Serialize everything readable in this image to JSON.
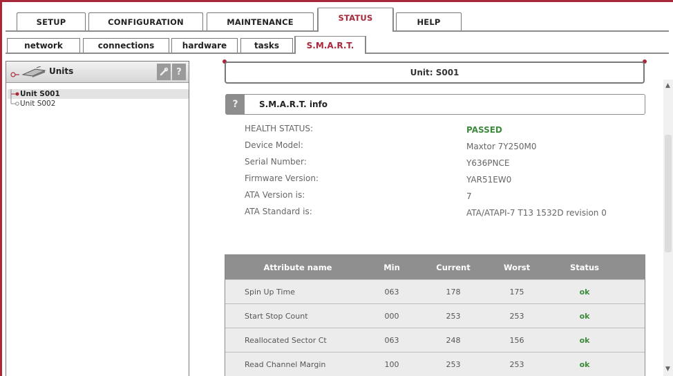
{
  "main_tabs": [
    {
      "label": "SETUP",
      "active": false
    },
    {
      "label": "CONFIGURATION",
      "active": false
    },
    {
      "label": "MAINTENANCE",
      "active": false
    },
    {
      "label": "STATUS",
      "active": true
    },
    {
      "label": "HELP",
      "active": false
    }
  ],
  "sub_tabs": [
    {
      "label": "network",
      "active": false
    },
    {
      "label": "connections",
      "active": false
    },
    {
      "label": "hardware",
      "active": false
    },
    {
      "label": "tasks",
      "active": false
    },
    {
      "label": "S.M.A.R.T.",
      "active": true
    }
  ],
  "units_panel": {
    "title": "Units",
    "edit_icon": "wrench-icon",
    "help_label": "?",
    "units": [
      {
        "label": "Unit S001",
        "selected": true
      },
      {
        "label": "Unit S002",
        "selected": false
      }
    ]
  },
  "unit_header": "Unit: S001",
  "smart_info": {
    "help_label": "?",
    "title": "S.M.A.R.T. info",
    "rows": [
      {
        "label": "HEALTH STATUS:",
        "value": "PASSED"
      },
      {
        "label": "Device Model:",
        "value": "Maxtor 7Y250M0"
      },
      {
        "label": "Serial Number:",
        "value": "Y636PNCE"
      },
      {
        "label": "Firmware Version:",
        "value": "YAR51EW0"
      },
      {
        "label": "ATA Version is:",
        "value": "7"
      },
      {
        "label": "ATA Standard is:",
        "value": "ATA/ATAPI-7 T13 1532D revision 0"
      }
    ]
  },
  "attributes": {
    "headers": {
      "name": "Attribute name",
      "min": "Min",
      "current": "Current",
      "worst": "Worst",
      "status": "Status"
    },
    "rows": [
      {
        "name": "Spin Up Time",
        "min": "063",
        "current": "178",
        "worst": "175",
        "status": "ok"
      },
      {
        "name": "Start Stop Count",
        "min": "000",
        "current": "253",
        "worst": "253",
        "status": "ok"
      },
      {
        "name": "Reallocated Sector Ct",
        "min": "063",
        "current": "248",
        "worst": "156",
        "status": "ok"
      },
      {
        "name": "Read Channel Margin",
        "min": "100",
        "current": "253",
        "worst": "253",
        "status": "ok"
      }
    ]
  },
  "colors": {
    "accent": "#a8283a",
    "ok": "#3b8b3b",
    "table_header": "#8f8f8f"
  }
}
